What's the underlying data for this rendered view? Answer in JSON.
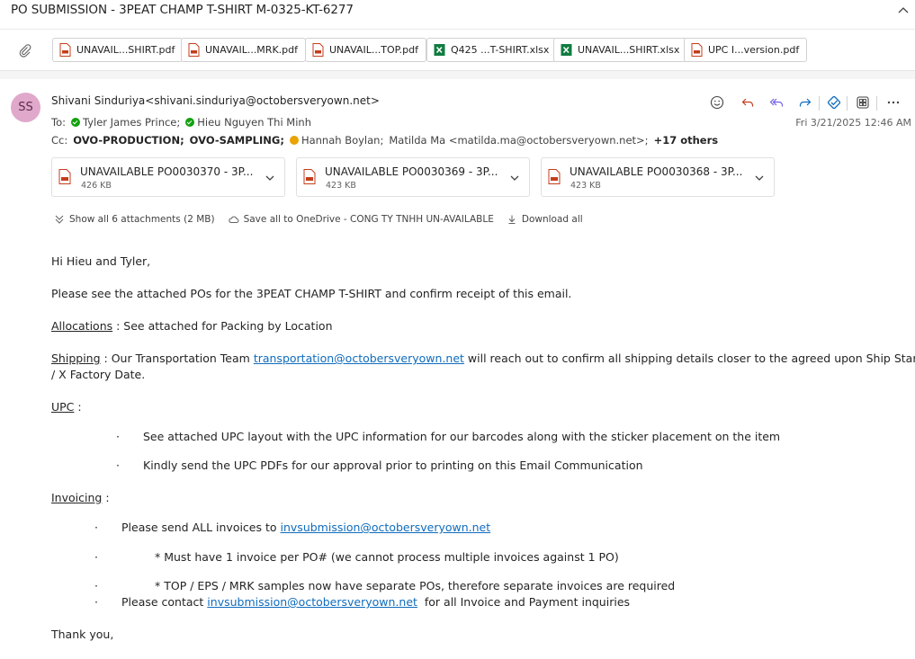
{
  "subject": "PO SUBMISSION - 3PEAT CHAMP T-SHIRT M-0325-KT-6277",
  "attachment_chips": [
    {
      "label": "UNAVAIL...SHIRT.pdf",
      "type": "pdf"
    },
    {
      "label": "UNAVAIL...MRK.pdf",
      "type": "pdf"
    },
    {
      "label": "UNAVAIL...TOP.pdf",
      "type": "pdf"
    },
    {
      "label": "Q425 ...T-SHIRT.xlsx",
      "type": "xlsx"
    },
    {
      "label": "UNAVAIL...SHIRT.xlsx",
      "type": "xlsx"
    },
    {
      "label": "UPC I...version.pdf",
      "type": "pdf"
    }
  ],
  "sender": {
    "initials": "SS",
    "display": "Shivani Sinduriya<shivani.sinduriya@octobersveryown.net>"
  },
  "to": {
    "label": "To:",
    "recipients": [
      "Tyler James Prince;",
      "Hieu Nguyen Thi Minh"
    ]
  },
  "cc": {
    "label": "Cc:",
    "groups": [
      "OVO-PRODUCTION;",
      "OVO-SAMPLING;"
    ],
    "people": [
      "Hannah Boylan;",
      "Matilda Ma <matilda.ma@octobersveryown.net>;"
    ],
    "more": "+17 others"
  },
  "date": "Fri 3/21/2025 12:46 AM",
  "attachments": [
    {
      "name": "UNAVAILABLE PO0030370 - 3P...",
      "size": "426 KB"
    },
    {
      "name": "UNAVAILABLE PO0030369 - 3P...",
      "size": "423 KB"
    },
    {
      "name": "UNAVAILABLE PO0030368 - 3P...",
      "size": "423 KB"
    }
  ],
  "attachment_actions": {
    "show_all": "Show all 6 attachments (2 MB)",
    "save_all": "Save all to OneDrive - CONG TY TNHH UN-AVAILABLE",
    "download_all": "Download all"
  },
  "body": {
    "greeting": "Hi Hieu and Tyler,",
    "intro": "Please see the attached POs for the 3PEAT CHAMP T-SHIRT and confirm receipt of this email.",
    "allocations_label": "Allocations",
    "allocations_text": " : See attached for Packing by Location",
    "shipping_label": "Shipping",
    "shipping_pre": " : Our Transportation Team ",
    "shipping_link": "transportation@octobersveryown.net",
    "shipping_post": " will reach out to confirm all shipping details closer to the agreed upon Ship Start Date",
    "shipping_line2": "/ X Factory Date.",
    "upc_label": "UPC",
    "upc_colon": " :",
    "upc_bullets": [
      "See attached UPC layout with the UPC information for our barcodes along with the sticker placement on the item",
      "Kindly send the UPC PDFs for our approval prior to printing on this Email Communication"
    ],
    "invoicing_label": "Invoicing",
    "invoicing_colon": " :",
    "invoice_send_pre": "Please send ALL invoices to ",
    "invoice_link": "invsubmission@octobersveryown.net",
    "invoice_note1": "* Must have 1 invoice per PO# (we cannot process multiple invoices against 1 PO)",
    "invoice_note2": "* TOP / EPS / MRK samples now have separate POs, therefore separate invoices are required",
    "contact_pre": "Please contact ",
    "contact_link": "invsubmission@octobersveryown.net",
    "contact_post": "  for all Invoice and Payment inquiries",
    "bullet_char": "·",
    "signoff": "Thank you,"
  }
}
